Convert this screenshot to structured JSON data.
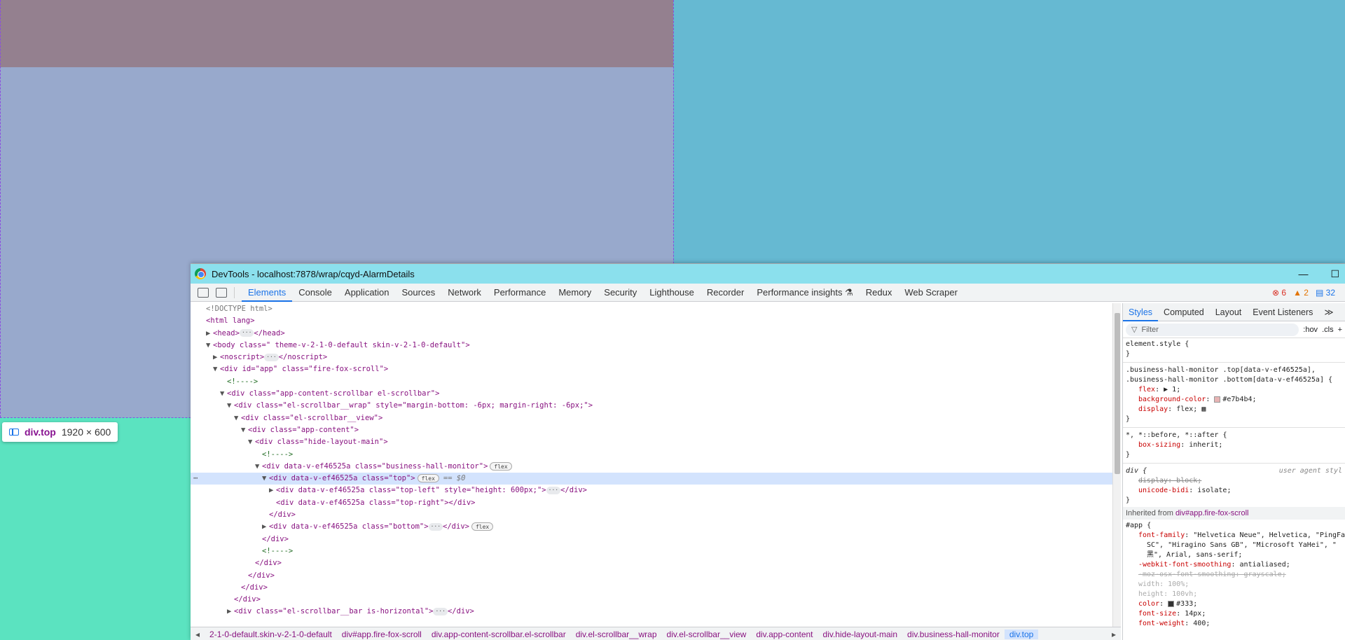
{
  "page": {
    "colors": {
      "top_left_head": "#94808f",
      "top_left": "#98a9cc",
      "top_right": "#66b9d2",
      "bottom": "#5be3c0"
    }
  },
  "tooltip": {
    "tag": "div.top",
    "dims": "1920 × 600"
  },
  "devtools": {
    "title": "DevTools - localhost:7878/wrap/cqyd-AlarmDetails",
    "window_min": "—",
    "window_max": "☐",
    "tabs": [
      "Elements",
      "Console",
      "Application",
      "Sources",
      "Network",
      "Performance",
      "Memory",
      "Security",
      "Lighthouse",
      "Recorder",
      "Performance insights ⚗",
      "Redux",
      "Web Scraper"
    ],
    "counts": {
      "errors": "6",
      "warnings": "2",
      "messages": "32"
    },
    "dom_lines": [
      {
        "indent": 0,
        "tri": "",
        "text": "<!DOCTYPE html>",
        "cls": "doc"
      },
      {
        "indent": 0,
        "tri": "",
        "text": "<html lang>"
      },
      {
        "indent": 1,
        "tri": "▶",
        "text": "<head>",
        "dots": true,
        "after": "</head>"
      },
      {
        "indent": 1,
        "tri": "▼",
        "text": "<body class=\" theme-v-2-1-0-default skin-v-2-1-0-default\">"
      },
      {
        "indent": 2,
        "tri": "▶",
        "text": "<noscript>",
        "dots": true,
        "after": "</noscript>"
      },
      {
        "indent": 2,
        "tri": "▼",
        "text": "<div id=\"app\" class=\"fire-fox-scroll\">"
      },
      {
        "indent": 3,
        "tri": "",
        "text": "<!---->",
        "cls": "comment"
      },
      {
        "indent": 3,
        "tri": "▼",
        "text": "<div class=\"app-content-scrollbar el-scrollbar\">"
      },
      {
        "indent": 4,
        "tri": "▼",
        "text": "<div class=\"el-scrollbar__wrap\" style=\"margin-bottom: -6px; margin-right: -6px;\">"
      },
      {
        "indent": 5,
        "tri": "▼",
        "text": "<div class=\"el-scrollbar__view\">"
      },
      {
        "indent": 6,
        "tri": "▼",
        "text": "<div class=\"app-content\">"
      },
      {
        "indent": 7,
        "tri": "▼",
        "text": "<div class=\"hide-layout-main\">"
      },
      {
        "indent": 8,
        "tri": "",
        "text": "<!---->",
        "cls": "comment"
      },
      {
        "indent": 8,
        "tri": "▼",
        "text": "<div data-v-ef46525a class=\"business-hall-monitor\">",
        "badge": "flex"
      },
      {
        "indent": 9,
        "tri": "▼",
        "text": "<div data-v-ef46525a class=\"top\">",
        "badge": "flex",
        "eq": "== $0",
        "selected": true
      },
      {
        "indent": 10,
        "tri": "▶",
        "text": "<div data-v-ef46525a class=\"top-left\" style=\"height: 600px;\">",
        "dots": true,
        "after": "</div>"
      },
      {
        "indent": 10,
        "tri": "",
        "text": "<div data-v-ef46525a class=\"top-right\"></div>"
      },
      {
        "indent": 9,
        "tri": "",
        "text": "</div>"
      },
      {
        "indent": 9,
        "tri": "▶",
        "text": "<div data-v-ef46525a class=\"bottom\">",
        "dots": true,
        "after": "</div>",
        "badge": "flex"
      },
      {
        "indent": 8,
        "tri": "",
        "text": "</div>"
      },
      {
        "indent": 8,
        "tri": "",
        "text": "<!---->",
        "cls": "comment"
      },
      {
        "indent": 7,
        "tri": "",
        "text": "</div>"
      },
      {
        "indent": 6,
        "tri": "",
        "text": "</div>"
      },
      {
        "indent": 5,
        "tri": "",
        "text": "</div>"
      },
      {
        "indent": 4,
        "tri": "",
        "text": "</div>"
      },
      {
        "indent": 4,
        "tri": "▶",
        "text": "<div class=\"el-scrollbar__bar is-horizontal\">",
        "dots": true,
        "after": "</div>"
      }
    ],
    "breadcrumbs": [
      "◂",
      "2-1-0-default.skin-v-2-1-0-default",
      "div#app.fire-fox-scroll",
      "div.app-content-scrollbar.el-scrollbar",
      "div.el-scrollbar__wrap",
      "div.el-scrollbar__view",
      "div.app-content",
      "div.hide-layout-main",
      "div.business-hall-monitor",
      "div.top",
      "▸"
    ],
    "styles": {
      "tabs": [
        "Styles",
        "Computed",
        "Layout",
        "Event Listeners",
        "≫"
      ],
      "filter_placeholder": "Filter",
      "hov": ":hov",
      "cls": ".cls",
      "plus": "+",
      "element_style": "element.style {",
      "close": "}",
      "rule1_sel1": ".business-hall-monitor .top[data-v-ef46525a],",
      "rule1_sel2": ".business-hall-monitor .bottom[data-v-ef46525a] {",
      "rule1_flex": "flex",
      "rule1_flex_v": "▶ 1;",
      "rule1_bg": "background-color",
      "rule1_bg_v": "#e7b4b4;",
      "rule1_bg_color": "#e7b4b4",
      "rule1_disp": "display",
      "rule1_disp_v": "flex;",
      "rule2_sel": "*, *::before, *::after {",
      "rule2_bs": "box-sizing",
      "rule2_bs_v": "inherit;",
      "rule3_sel": "div {",
      "rule3_ua": "user agent styl",
      "rule3_disp": "display: block;",
      "rule3_ub": "unicode-bidi",
      "rule3_ub_v": "isolate;",
      "inherited_label": "Inherited from",
      "inherited_el": "div#app.fire-fox-scroll",
      "app_sel": "#app {",
      "ff": "font-family",
      "ff_v": "\"Helvetica Neue\", Helvetica, \"PingFa",
      "ff_v2": "SC\", \"Hiragino Sans GB\", \"Microsoft YaHei\", \"",
      "ff_v3": "黑\", Arial, sans-serif;",
      "wfs": "-webkit-font-smoothing",
      "wfs_v": "antialiased;",
      "moz": "-moz-osx-font-smoothing: grayscale;",
      "w": "width: 100%;",
      "h": "height: 100vh;",
      "color": "color",
      "color_v": "#333;",
      "color_swatch": "#333333",
      "fs": "font-size",
      "fs_v": "14px;",
      "fw": "font-weight",
      "fw_v": "400;"
    }
  }
}
